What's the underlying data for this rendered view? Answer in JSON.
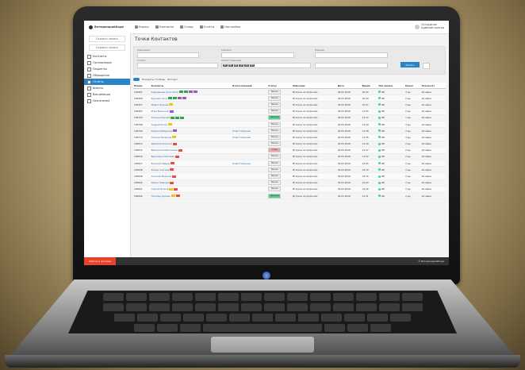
{
  "app": {
    "brand": "ВетеринарийКоде",
    "nav": [
      "Корпус",
      "Контакты",
      "Склад",
      "Отчёты",
      "Настройки"
    ],
    "user": [
      "Сотрудник",
      "Администратор"
    ]
  },
  "sidebar": {
    "button": "Создать запись",
    "items": [
      "Контакты",
      "Организации",
      "Пациенты",
      "Обращения",
      "Отчёты",
      "Визиты",
      "Вакцинации",
      "Назначения"
    ],
    "active_index": 4
  },
  "page": {
    "title": "Точки Контактов"
  },
  "filters": {
    "labels": [
      "Кампания",
      "Сегмент",
      "Период",
      "Статус",
      "Ответственный"
    ],
    "tags": [
      "MT",
      "MT",
      "MT",
      "MT",
      "MT",
      "MT"
    ],
    "search_button": "Искать"
  },
  "toolbar": {
    "label": "Показать столбцы",
    "extra": "Экспорт"
  },
  "table": {
    "headers": [
      "Номер",
      "Контакты",
      "Ответственный",
      "Статус",
      "Описание",
      "Дата",
      "Время",
      "Тип звонка",
      "Канал",
      "Результат"
    ],
    "rows": [
      {
        "id": "100897",
        "name": "Кудрявцева Анастасия",
        "resp": "",
        "status": "Звонок",
        "desc": "Встреча по вопросам",
        "date": "04.05.2018",
        "time": "10:32",
        "type": "ВК",
        "ch": "3 дн.",
        "res": "Активен",
        "badges": [
          "#2ea44f",
          "#2ea44f",
          "#9b59b6",
          "#9b59b6"
        ],
        "stat": ""
      },
      {
        "id": "100906",
        "name": "Буренин Олег",
        "resp": "",
        "status": "Звонок",
        "desc": "Встреча по вопросам",
        "date": "04.05.2018",
        "time": "10:40",
        "type": "ВК",
        "ch": "2 дн.",
        "res": "Активен",
        "badges": [
          "#2ea44f",
          "#2ea44f",
          "#9b59b6",
          "#9b59b6"
        ],
        "stat": ""
      },
      {
        "id": "100957",
        "name": "Мария Жукова",
        "resp": "",
        "status": "Звонок",
        "desc": "Встреча по вопросам",
        "date": "04.05.2018",
        "time": "10:57",
        "type": "ВК",
        "ch": "2 дн.",
        "res": "Активен",
        "badges": [
          "#f1c40f"
        ],
        "stat": ""
      },
      {
        "id": "100967",
        "name": "Илья Бельский",
        "resp": "",
        "status": "Звонок",
        "desc": "Встреча по вопросам",
        "date": "04.05.2018",
        "time": "11:05",
        "type": "ВК",
        "ch": "2 дн.",
        "res": "Активен",
        "badges": [
          "#9b59b6"
        ],
        "stat": ""
      },
      {
        "id": "100754",
        "name": "Татьяна Кирова",
        "resp": "",
        "status": "Принята",
        "desc": "Встреча по вопросам",
        "date": "04.05.2018",
        "time": "11:12",
        "type": "ВК",
        "ch": "1 дн.",
        "res": "Активен",
        "badges": [
          "#2ea44f",
          "#2ea44f",
          "#2ea44f"
        ],
        "stat": "g"
      },
      {
        "id": "100768",
        "name": "Андрей Русов",
        "resp": "",
        "status": "Звонок",
        "desc": "Встреча по вопросам",
        "date": "04.05.2018",
        "time": "11:20",
        "type": "ВК",
        "ch": "3 дн.",
        "res": "Активен",
        "badges": [
          "#f1c40f"
        ],
        "stat": ""
      },
      {
        "id": "100769",
        "name": "Кирилл Бабушкин",
        "resp": "Ответственный",
        "status": "Звонок",
        "desc": "Встреча по вопросам",
        "date": "04.05.2018",
        "time": "11:28",
        "type": "ВК",
        "ch": "3 дн.",
        "res": "Активен",
        "badges": [
          "#9b59b6"
        ],
        "stat": ""
      },
      {
        "id": "100770",
        "name": "Полина Захарова",
        "resp": "Ответственный",
        "status": "Звонок",
        "desc": "Встреча по вопросам",
        "date": "04.05.2018",
        "time": "11:35",
        "type": "ВК",
        "ch": "3 дн.",
        "res": "Активен",
        "badges": [
          "#f1c40f"
        ],
        "stat": ""
      },
      {
        "id": "100814",
        "name": "Дмитрий Колосов",
        "resp": "",
        "status": "Звонок",
        "desc": "Встреча по вопросам",
        "date": "04.05.2018",
        "time": "11:40",
        "type": "ВК",
        "ch": "2 дн.",
        "res": "Активен",
        "badges": [
          "#e74c3c"
        ],
        "stat": ""
      },
      {
        "id": "100815",
        "name": "Валентина Максимова",
        "resp": "",
        "status": "Отказ",
        "desc": "Встреча по вопросам",
        "date": "04.05.2018",
        "time": "11:47",
        "type": "ВК",
        "ch": "2 дн.",
        "res": "Активен",
        "badges": [
          "#e74c3c"
        ],
        "stat": "r"
      },
      {
        "id": "100816",
        "name": "Вероника Соболева",
        "resp": "",
        "status": "Звонок",
        "desc": "Встреча по вопросам",
        "date": "04.05.2018",
        "time": "11:52",
        "type": "ВК",
        "ch": "2 дн.",
        "res": "Активен",
        "badges": [
          "#e74c3c"
        ],
        "stat": ""
      },
      {
        "id": "100827",
        "name": "Евгений Лавров",
        "resp": "Ответственный",
        "status": "Звонок",
        "desc": "Встреча по вопросам",
        "date": "04.05.2018",
        "time": "12:05",
        "type": "ВК",
        "ch": "2 дн.",
        "res": "Активен",
        "badges": [
          "#e74c3c"
        ],
        "stat": ""
      },
      {
        "id": "100838",
        "name": "Фёдор Сергеев",
        "resp": "",
        "status": "Звонок",
        "desc": "Встреча по вопросам",
        "date": "04.05.2018",
        "time": "12:10",
        "type": "ВК",
        "ch": "2 дн.",
        "res": "Активен",
        "badges": [
          "#e74c3c"
        ],
        "stat": ""
      },
      {
        "id": "100839",
        "name": "Алексей Морозов",
        "resp": "",
        "status": "Звонок",
        "desc": "Встреча по вопросам",
        "date": "04.05.2018",
        "time": "12:15",
        "type": "ВК",
        "ch": "2 дн.",
        "res": "Активен",
        "badges": [
          "#e74c3c"
        ],
        "stat": ""
      },
      {
        "id": "100840",
        "name": "Ирина Павлова",
        "resp": "",
        "status": "Звонок",
        "desc": "Встреча по вопросам",
        "date": "04.05.2018",
        "time": "12:20",
        "type": "ВК",
        "ch": "2 дн.",
        "res": "Активен",
        "badges": [
          "#e74c3c"
        ],
        "stat": ""
      },
      {
        "id": "100841",
        "name": "Сергей Волков",
        "resp": "",
        "status": "Звонок",
        "desc": "Встреча по вопросам",
        "date": "04.05.2018",
        "time": "12:26",
        "type": "ВК",
        "ch": "2 дн.",
        "res": "Активен",
        "badges": [
          "#f1c40f",
          "#e74c3c"
        ],
        "stat": ""
      },
      {
        "id": "100842",
        "name": "Наталья Орлова",
        "resp": "",
        "status": "Принята",
        "desc": "Встреча по вопросам",
        "date": "04.05.2018",
        "time": "12:31",
        "type": "ВК",
        "ch": "2 дн.",
        "res": "Активен",
        "badges": [
          "#f1c40f",
          "#e74c3c"
        ],
        "stat": "g"
      }
    ]
  },
  "footer": {
    "left": "Работа в системе",
    "right": "© ВетеринарийКоде"
  },
  "colors": {
    "accent": "#2b84c8",
    "danger": "#e8432c",
    "ok": "#4fd38a"
  }
}
